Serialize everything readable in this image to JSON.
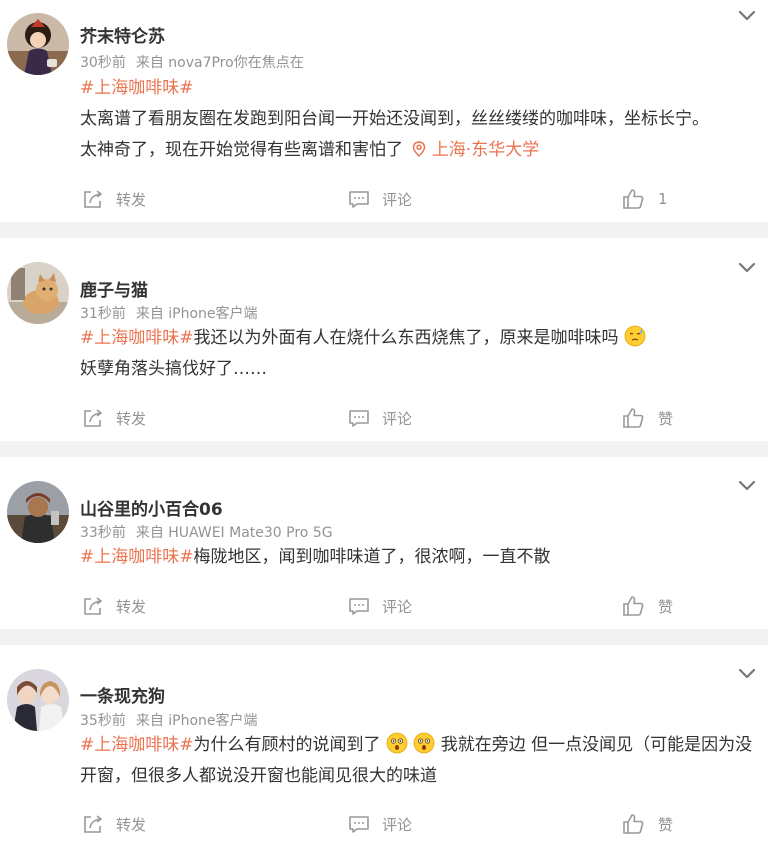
{
  "actions": {
    "repost": "转发",
    "comment": "评论",
    "like": "赞"
  },
  "comments": [
    {
      "username": "芥末特仑苏",
      "time": "30秒前",
      "source": "来自 nova7Pro你在焦点在",
      "hashtag": "#上海咖啡味#",
      "text_line1": "太离谱了看朋友圈在发跑到阳台闻一开始还没闻到，丝丝缕缕的咖啡味，坐标长宁。",
      "text_line2": "太神奇了，现在开始觉得有些离谱和害怕了",
      "location": "上海·东华大学",
      "like_count": "1"
    },
    {
      "username": "鹿子与猫",
      "time": "31秒前",
      "source": "来自 iPhone客户端",
      "hashtag": "#上海咖啡味#",
      "text_line1": "我还以为外面有人在烧什么东西烧焦了，原来是咖啡味吗",
      "text_line2": "妖孽角落头搞伐好了……",
      "emoji": "sweat-face"
    },
    {
      "username": "山谷里的小百合06",
      "time": "33秒前",
      "source": "来自 HUAWEI Mate30 Pro 5G",
      "hashtag": "#上海咖啡味#",
      "text_line1": "梅陇地区，闻到咖啡味道了，很浓啊，一直不散"
    },
    {
      "username": "一条现充狗",
      "time": "35秒前",
      "source": "来自 iPhone客户端",
      "hashtag": "#上海咖啡味#",
      "text_part1": "为什么有顾村的说闻到了",
      "text_part2": "我就在旁边 但一点没闻见（可能是因为没",
      "text_line2": "开窗，但很多人都说没开窗也能闻见很大的味道",
      "emoji": "astonished-face"
    }
  ],
  "colors": {
    "accent": "#eb7350",
    "meta": "#939393",
    "text": "#333333",
    "divider": "#f2f2f2"
  }
}
